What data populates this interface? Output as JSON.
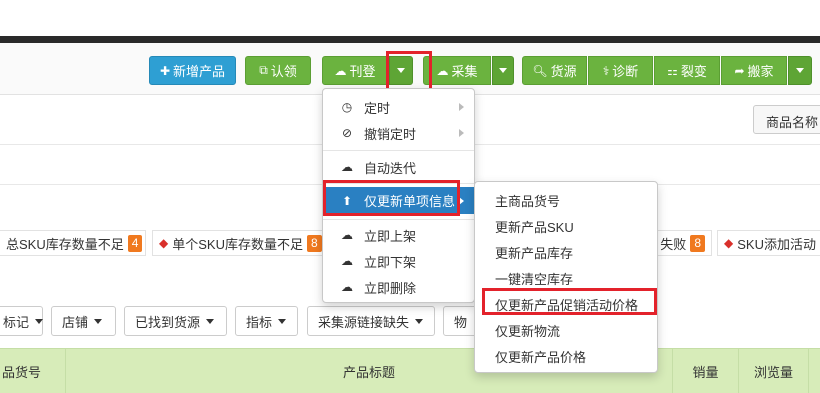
{
  "toolbar": {
    "add_product": "新增产品",
    "claim": "认领",
    "publish": "刊登",
    "collect": "采集",
    "source": "货源",
    "diagnose": "诊断",
    "split": "裂变",
    "move": "搬家"
  },
  "sort_button": "商品名称",
  "tags": [
    {
      "label": "总SKU库存数量不足",
      "count": "4"
    },
    {
      "label": "单个SKU库存数量不足",
      "count": "8"
    },
    {
      "label": "失败",
      "count": "8"
    },
    {
      "label": "SKU添加活动"
    }
  ],
  "filters": [
    "标记",
    "店铺",
    "已找到货源",
    "指标",
    "采集源链接缺失",
    "物"
  ],
  "table_headers": [
    "品货号",
    "产品标题",
    "销量",
    "浏览量"
  ],
  "publish_menu": {
    "items": [
      {
        "label": "定时",
        "icon": "clock-icon",
        "has_submenu": true
      },
      {
        "label": "撤销定时",
        "icon": "ban-icon",
        "has_submenu": true
      },
      {
        "label": "自动迭代",
        "icon": "cloud-upload-icon"
      },
      {
        "label": "仅更新单项信息",
        "icon": "arrow-circle-up-icon",
        "has_submenu": true,
        "active": true
      },
      {
        "label": "立即上架",
        "icon": "cloud-upload-icon"
      },
      {
        "label": "立即下架",
        "icon": "cloud-download-icon"
      },
      {
        "label": "立即删除",
        "icon": "cloud-delete-icon"
      }
    ]
  },
  "update_submenu": {
    "items": [
      "主商品货号",
      "更新产品SKU",
      "更新产品库存",
      "一键清空库存",
      "仅更新产品促销活动价格",
      "仅更新物流",
      "仅更新产品价格"
    ]
  },
  "colors": {
    "primary_blue": "#2e9fd3",
    "toolbar_green": "#6bb33f",
    "menu_highlight": "#2a80c2",
    "annotation_red": "#e3222b",
    "badge_orange": "#f0791f",
    "table_header_green": "#d7ecb9"
  }
}
